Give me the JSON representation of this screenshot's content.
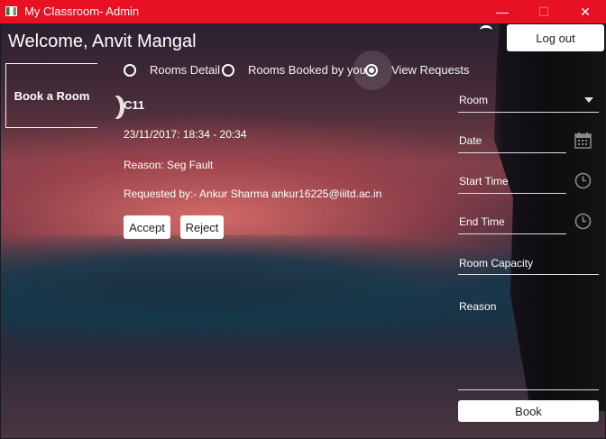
{
  "window": {
    "title": "My Classroom- Admin"
  },
  "header": {
    "welcome": "Welcome, Anvit Mangal",
    "logout_label": "Log out"
  },
  "sidebar": {
    "book_room_label": "Book a Room"
  },
  "tabs": [
    {
      "label": "Rooms Detail",
      "selected": false
    },
    {
      "label": "Rooms Booked by you",
      "selected": false
    },
    {
      "label": "View Requests",
      "selected": true
    }
  ],
  "request": {
    "room": "C11",
    "time": "23/11/2017: 18:34 - 20:34",
    "reason": "Reason: Seg Fault",
    "requested_by": "Requested by:- Ankur Sharma ankur16225@iiitd.ac.in",
    "accept_label": "Accept",
    "reject_label": "Reject"
  },
  "form": {
    "room_label": "Room",
    "date_label": "Date",
    "start_label": "Start Time",
    "end_label": "End Time",
    "capacity_label": "Room Capacity",
    "reason_label": "Reason",
    "book_label": "Book"
  },
  "colors": {
    "titlebar": "#e81123",
    "button_bg": "#ffffff"
  }
}
